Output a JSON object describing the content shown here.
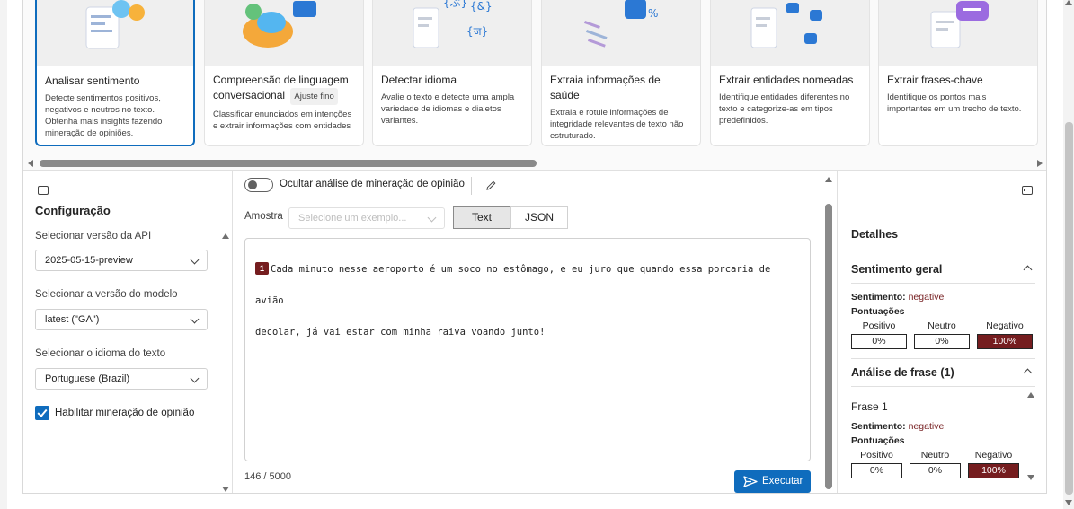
{
  "cards": [
    {
      "title": "Analisar sentimento",
      "desc": "Detecte sentimentos positivos, negativos e neutros no texto. Obtenha mais insights fazendo mineração de opiniões.",
      "selected": true
    },
    {
      "title": "Compreensão de linguagem conversacional",
      "tag": "Ajuste fino",
      "desc": "Classificar enunciados em intenções e extrair informações com entidades"
    },
    {
      "title": "Detectar idioma",
      "desc": "Avalie o texto e detecte uma ampla variedade de idiomas e dialetos variantes."
    },
    {
      "title": "Extraia informações de saúde",
      "desc": "Extraia e rotule informações de integridade relevantes de texto não estruturado."
    },
    {
      "title": "Extrair entidades nomeadas",
      "desc": "Identifique entidades diferentes no texto e categorize-as em tipos predefinidos."
    },
    {
      "title": "Extrair frases-chave",
      "desc": "Identifique os pontos mais importantes em um trecho de texto."
    }
  ],
  "config": {
    "title": "Configuração",
    "api_label": "Selecionar versão da API",
    "api_value": "2025-05-15-preview",
    "model_label": "Selecionar a versão do modelo",
    "model_value": "latest (\"GA\")",
    "lang_label": "Selecionar o idioma do texto",
    "lang_value": "Portuguese (Brazil)",
    "opinion_label": "Habilitar mineração de opinião",
    "opinion_checked": true
  },
  "editor": {
    "toggle_label": "Ocultar análise de mineração de opinião",
    "sample_label": "Amostra",
    "sample_placeholder": "Selecione um exemplo...",
    "tab_text": "Text",
    "tab_json": "JSON",
    "sentence_number": "1",
    "line1": "Cada minuto nesse aeroporto é um soco no estômago, e eu juro que quando essa porcaria de avião",
    "line2": "decolar, já vai estar com minha raiva voando junto!",
    "char_count": "146 / 5000",
    "run_label": "Executar"
  },
  "details": {
    "title": "Detalhes",
    "overall_title": "Sentimento geral",
    "sentiment_label": "Sentimento:",
    "sentiment_value": "negative",
    "scores_label": "Pontuações",
    "pos_label": "Positivo",
    "neu_label": "Neutro",
    "neg_label": "Negativo",
    "pos": "0%",
    "neu": "0%",
    "neg": "100%",
    "sentence_section_title": "Análise de frase (1)",
    "sentence_title": "Frase 1",
    "s1_sentiment": "negative",
    "s1_pos": "0%",
    "s1_neu": "0%",
    "s1_neg": "100%"
  },
  "colors": {
    "accent": "#0f6cbd",
    "negative": "#751d1f"
  }
}
